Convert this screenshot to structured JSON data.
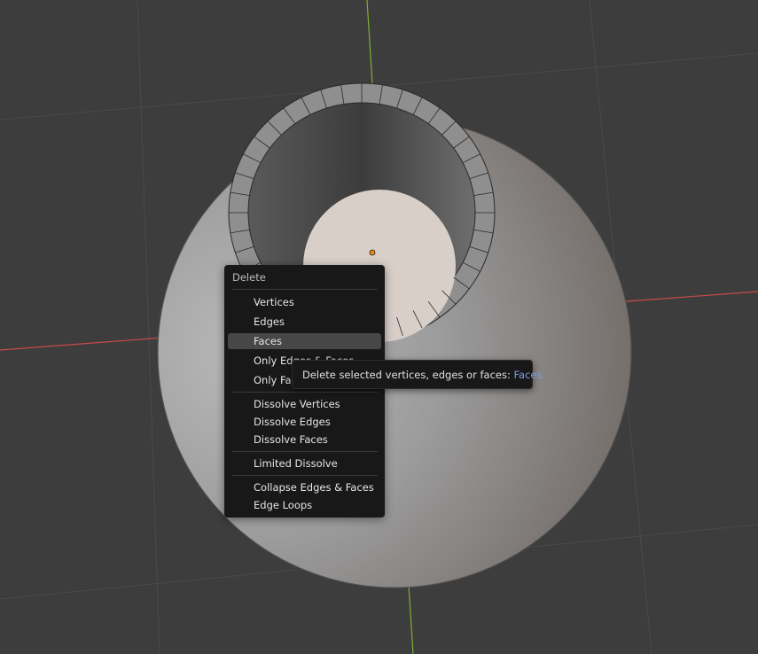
{
  "menu": {
    "title": "Delete",
    "items": [
      {
        "label": "Vertices",
        "name": "vertices"
      },
      {
        "label": "Edges",
        "name": "edges"
      },
      {
        "label": "Faces",
        "name": "faces",
        "active": true
      },
      {
        "label": "Only Edges & Faces",
        "name": "only-edges-faces"
      },
      {
        "label": "Only Faces",
        "name": "only-faces"
      },
      {
        "label": "Dissolve Vertices",
        "name": "dissolve-vertices"
      },
      {
        "label": "Dissolve Edges",
        "name": "dissolve-edges"
      },
      {
        "label": "Dissolve Faces",
        "name": "dissolve-faces"
      },
      {
        "label": "Limited Dissolve",
        "name": "limited-dissolve"
      },
      {
        "label": "Collapse Edges & Faces",
        "name": "collapse-edges-faces"
      },
      {
        "label": "Edge Loops",
        "name": "edge-loops"
      }
    ]
  },
  "tooltip": {
    "text": "Delete selected vertices, edges or faces: ",
    "value": "Faces"
  },
  "colors": {
    "viewport_bg": "#3d3d3d",
    "grid_line": "#4a4a4a",
    "x_axis": "#c94a4a",
    "y_axis": "#7fae2f",
    "menu_bg": "#181818",
    "menu_highlight": "#474747",
    "tooltip_accent": "#7b9fdc",
    "origin_dot": "#f08a1e"
  }
}
